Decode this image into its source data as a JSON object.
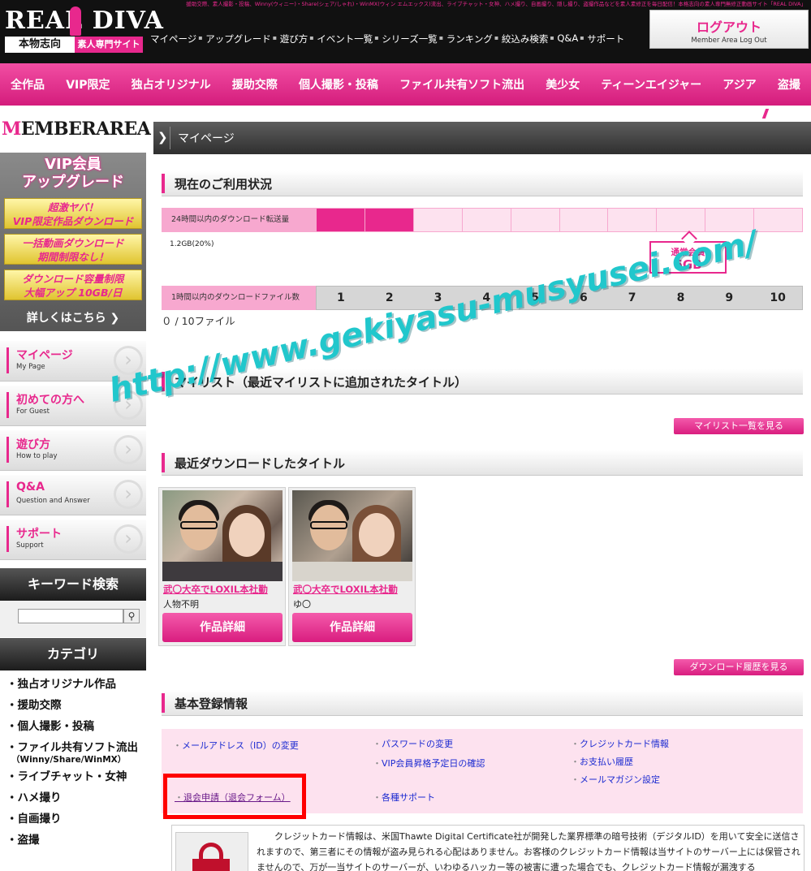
{
  "header": {
    "topline": "援助交際、素人撮影・投稿、Winny(ウィニー)・Share(シェア/しゃれ)・WinMX(ウィン エムエックス)流出、ライブチャット・女神、ハメ撮り、自画撮り、隠し撮り、盗撮作品などを素人素修正を毎日配信！本格志向の素人専門無修正動画サイト「REAL DIVA」",
    "logo_main": "REAL DIVA",
    "logo_sub_left": "本物志向",
    "logo_sub_right": "素人専門サイト",
    "nav": [
      "マイページ",
      "アップグレード",
      "遊び方",
      "イベント一覧",
      "シリーズ一覧",
      "ランキング",
      "絞込み検索",
      "Q&A",
      "サポート"
    ],
    "logout_label": "ログアウト",
    "logout_sub": "Member Area Log Out"
  },
  "category_nav": [
    "全作品",
    "VIP限定",
    "独占オリジナル",
    "援助交際",
    "個人撮影・投稿",
    "ファイル共有ソフト流出",
    "美少女",
    "ティーンエイジャー",
    "アジア",
    "盗撮"
  ],
  "sidebar": {
    "member_area_prefix": "M",
    "member_area_rest": "EMBERAREA",
    "upgrade_title": "VIP会員\nアップグレード",
    "upgrade_items": [
      "超激ヤバ！\nVIP限定作品ダウンロード",
      "一括動画ダウンロード\n期間制限なし！",
      "ダウンロード容量制限\n大幅アップ 10GB/日"
    ],
    "upgrade_more": "詳しくはこちら ❯",
    "menu": [
      {
        "jp": "マイページ",
        "en": "My Page"
      },
      {
        "jp": "初めての方へ",
        "en": "For Guest"
      },
      {
        "jp": "遊び方",
        "en": "How to play"
      },
      {
        "jp": "Q&A",
        "en": "Question and Answer"
      },
      {
        "jp": "サポート",
        "en": "Support"
      }
    ],
    "keyword_search": "キーワード検索",
    "search_icon": "search-icon",
    "category_heading": "カテゴリ",
    "categories": [
      "・独占オリジナル作品",
      "・援助交際",
      "・個人撮影・投稿",
      "・ファイル共有ソフト流出",
      "・ライブチャット・女神",
      "・ハメ撮り",
      "・自画撮り",
      "・盗撮"
    ],
    "category_sub": "（Winny/Share/WinMX）"
  },
  "main": {
    "page_title": "マイページ",
    "usage": {
      "heading": "現在のご利用状況",
      "transfer_label": "24時間以内のダウンロード転送量",
      "transfer_used": "1.2GB(20%)",
      "transfer_fraction": 0.2,
      "member_type": "通常会員",
      "member_limit": "6GB",
      "files_label": "1時間以内のダウンロードファイル数",
      "file_numbers": [
        "1",
        "2",
        "3",
        "4",
        "5",
        "6",
        "7",
        "8",
        "9",
        "10"
      ],
      "file_count": "０ / 10ファイル"
    },
    "mylist": {
      "heading": "マイリスト（最近マイリストに追加されたタイトル）",
      "button": "マイリスト一覧を見る"
    },
    "recent": {
      "heading": "最近ダウンロードしたタイトル",
      "items": [
        {
          "title": "武〇大卒でLOXIL本社勤",
          "actor": "人物不明",
          "detail": "作品詳細"
        },
        {
          "title": "武〇大卒でLOXIL本社勤",
          "actor": "ゆ〇",
          "detail": "作品詳細"
        }
      ],
      "history_button": "ダウンロード履歴を見る"
    },
    "registration": {
      "heading": "基本登録情報",
      "links": {
        "email": "メールアドレス（ID）の変更",
        "password": "パスワードの変更",
        "credit": "クレジットカード情報",
        "vip_date": "VIP会員昇格予定日の確認",
        "payment": "お支払い履歴",
        "mailmag": "メールマガジン設定",
        "withdraw": "退会申請（退会フォーム）",
        "support": "各種サポート"
      }
    },
    "security_text": "クレジットカード情報は、米国Thawte Digital Certificate社が開発した業界標準の暗号技術（デジタルID）を用いて安全に送信されますので、第三者にその情報が盗み見られる心配はありません。お客様のクレジットカード情報は当サイトのサーバー上には保管されませんので、万が一当サイトのサーバーが、いわゆるハッカー等の被害に遭った場合でも、クレジットカード情報が漏洩する"
  },
  "watermark": "http://www.gekiyasu-musyusei.com/",
  "colors": {
    "accent": "#e8288d",
    "accent_light": "#fde2ef",
    "watermark": "#21c7cc",
    "frame": "#ff0000"
  }
}
